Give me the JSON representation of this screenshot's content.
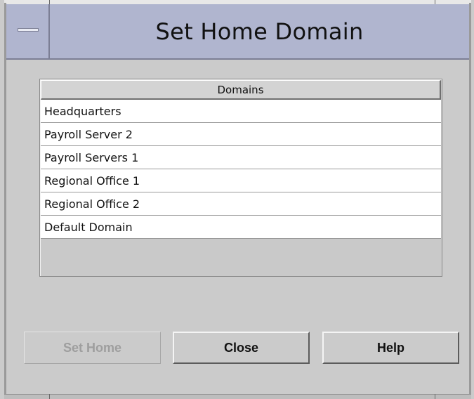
{
  "window": {
    "title": "Set Home Domain"
  },
  "table": {
    "header": "Domains",
    "rows": [
      "Headquarters",
      "Payroll Server 2",
      "Payroll Servers 1",
      "Regional Office 1",
      "Regional Office 2",
      "Default Domain"
    ]
  },
  "buttons": {
    "set_home": {
      "label": "Set Home",
      "enabled": false
    },
    "close": {
      "label": "Close",
      "enabled": true
    },
    "help": {
      "label": "Help",
      "enabled": true
    }
  },
  "colors": {
    "titlebar": "#b0b5cf",
    "window_bg": "#cbcbcb",
    "row_bg": "#ffffff",
    "disabled_text": "#9e9e9e"
  }
}
